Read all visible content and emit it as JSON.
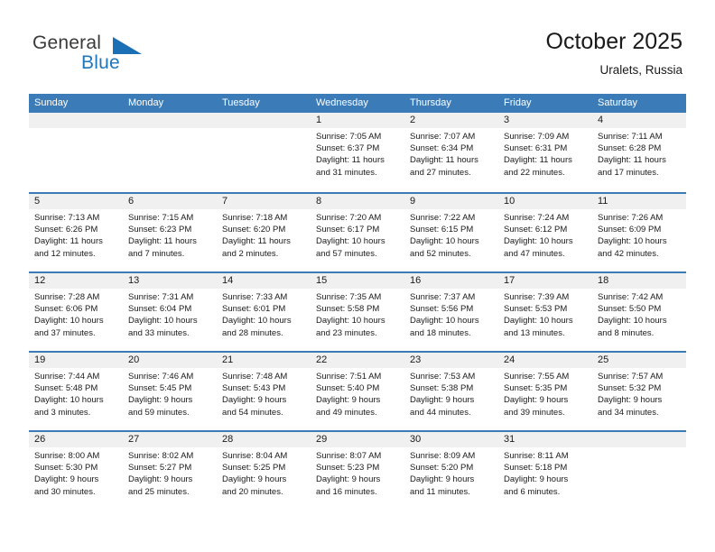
{
  "brand": {
    "name_top": "General",
    "name_bottom": "Blue",
    "triangle_color": "#1a6fb5",
    "top_color": "#3a3a3a",
    "bottom_color": "#1e76bd"
  },
  "header": {
    "title": "October 2025",
    "subtitle": "Uralets, Russia"
  },
  "calendar": {
    "header_bg": "#3b7cb8",
    "weekday_text_color": "#ffffff",
    "daynum_bg": "#f0f0f0",
    "weekdays": [
      "Sunday",
      "Monday",
      "Tuesday",
      "Wednesday",
      "Thursday",
      "Friday",
      "Saturday"
    ],
    "weeks": [
      [
        {
          "day": "",
          "empty": true
        },
        {
          "day": "",
          "empty": true
        },
        {
          "day": "",
          "empty": true
        },
        {
          "day": "1",
          "sunrise": "Sunrise: 7:05 AM",
          "sunset": "Sunset: 6:37 PM",
          "daylight_1": "Daylight: 11 hours",
          "daylight_2": "and 31 minutes."
        },
        {
          "day": "2",
          "sunrise": "Sunrise: 7:07 AM",
          "sunset": "Sunset: 6:34 PM",
          "daylight_1": "Daylight: 11 hours",
          "daylight_2": "and 27 minutes."
        },
        {
          "day": "3",
          "sunrise": "Sunrise: 7:09 AM",
          "sunset": "Sunset: 6:31 PM",
          "daylight_1": "Daylight: 11 hours",
          "daylight_2": "and 22 minutes."
        },
        {
          "day": "4",
          "sunrise": "Sunrise: 7:11 AM",
          "sunset": "Sunset: 6:28 PM",
          "daylight_1": "Daylight: 11 hours",
          "daylight_2": "and 17 minutes."
        }
      ],
      [
        {
          "day": "5",
          "sunrise": "Sunrise: 7:13 AM",
          "sunset": "Sunset: 6:26 PM",
          "daylight_1": "Daylight: 11 hours",
          "daylight_2": "and 12 minutes."
        },
        {
          "day": "6",
          "sunrise": "Sunrise: 7:15 AM",
          "sunset": "Sunset: 6:23 PM",
          "daylight_1": "Daylight: 11 hours",
          "daylight_2": "and 7 minutes."
        },
        {
          "day": "7",
          "sunrise": "Sunrise: 7:18 AM",
          "sunset": "Sunset: 6:20 PM",
          "daylight_1": "Daylight: 11 hours",
          "daylight_2": "and 2 minutes."
        },
        {
          "day": "8",
          "sunrise": "Sunrise: 7:20 AM",
          "sunset": "Sunset: 6:17 PM",
          "daylight_1": "Daylight: 10 hours",
          "daylight_2": "and 57 minutes."
        },
        {
          "day": "9",
          "sunrise": "Sunrise: 7:22 AM",
          "sunset": "Sunset: 6:15 PM",
          "daylight_1": "Daylight: 10 hours",
          "daylight_2": "and 52 minutes."
        },
        {
          "day": "10",
          "sunrise": "Sunrise: 7:24 AM",
          "sunset": "Sunset: 6:12 PM",
          "daylight_1": "Daylight: 10 hours",
          "daylight_2": "and 47 minutes."
        },
        {
          "day": "11",
          "sunrise": "Sunrise: 7:26 AM",
          "sunset": "Sunset: 6:09 PM",
          "daylight_1": "Daylight: 10 hours",
          "daylight_2": "and 42 minutes."
        }
      ],
      [
        {
          "day": "12",
          "sunrise": "Sunrise: 7:28 AM",
          "sunset": "Sunset: 6:06 PM",
          "daylight_1": "Daylight: 10 hours",
          "daylight_2": "and 37 minutes."
        },
        {
          "day": "13",
          "sunrise": "Sunrise: 7:31 AM",
          "sunset": "Sunset: 6:04 PM",
          "daylight_1": "Daylight: 10 hours",
          "daylight_2": "and 33 minutes."
        },
        {
          "day": "14",
          "sunrise": "Sunrise: 7:33 AM",
          "sunset": "Sunset: 6:01 PM",
          "daylight_1": "Daylight: 10 hours",
          "daylight_2": "and 28 minutes."
        },
        {
          "day": "15",
          "sunrise": "Sunrise: 7:35 AM",
          "sunset": "Sunset: 5:58 PM",
          "daylight_1": "Daylight: 10 hours",
          "daylight_2": "and 23 minutes."
        },
        {
          "day": "16",
          "sunrise": "Sunrise: 7:37 AM",
          "sunset": "Sunset: 5:56 PM",
          "daylight_1": "Daylight: 10 hours",
          "daylight_2": "and 18 minutes."
        },
        {
          "day": "17",
          "sunrise": "Sunrise: 7:39 AM",
          "sunset": "Sunset: 5:53 PM",
          "daylight_1": "Daylight: 10 hours",
          "daylight_2": "and 13 minutes."
        },
        {
          "day": "18",
          "sunrise": "Sunrise: 7:42 AM",
          "sunset": "Sunset: 5:50 PM",
          "daylight_1": "Daylight: 10 hours",
          "daylight_2": "and 8 minutes."
        }
      ],
      [
        {
          "day": "19",
          "sunrise": "Sunrise: 7:44 AM",
          "sunset": "Sunset: 5:48 PM",
          "daylight_1": "Daylight: 10 hours",
          "daylight_2": "and 3 minutes."
        },
        {
          "day": "20",
          "sunrise": "Sunrise: 7:46 AM",
          "sunset": "Sunset: 5:45 PM",
          "daylight_1": "Daylight: 9 hours",
          "daylight_2": "and 59 minutes."
        },
        {
          "day": "21",
          "sunrise": "Sunrise: 7:48 AM",
          "sunset": "Sunset: 5:43 PM",
          "daylight_1": "Daylight: 9 hours",
          "daylight_2": "and 54 minutes."
        },
        {
          "day": "22",
          "sunrise": "Sunrise: 7:51 AM",
          "sunset": "Sunset: 5:40 PM",
          "daylight_1": "Daylight: 9 hours",
          "daylight_2": "and 49 minutes."
        },
        {
          "day": "23",
          "sunrise": "Sunrise: 7:53 AM",
          "sunset": "Sunset: 5:38 PM",
          "daylight_1": "Daylight: 9 hours",
          "daylight_2": "and 44 minutes."
        },
        {
          "day": "24",
          "sunrise": "Sunrise: 7:55 AM",
          "sunset": "Sunset: 5:35 PM",
          "daylight_1": "Daylight: 9 hours",
          "daylight_2": "and 39 minutes."
        },
        {
          "day": "25",
          "sunrise": "Sunrise: 7:57 AM",
          "sunset": "Sunset: 5:32 PM",
          "daylight_1": "Daylight: 9 hours",
          "daylight_2": "and 34 minutes."
        }
      ],
      [
        {
          "day": "26",
          "sunrise": "Sunrise: 8:00 AM",
          "sunset": "Sunset: 5:30 PM",
          "daylight_1": "Daylight: 9 hours",
          "daylight_2": "and 30 minutes."
        },
        {
          "day": "27",
          "sunrise": "Sunrise: 8:02 AM",
          "sunset": "Sunset: 5:27 PM",
          "daylight_1": "Daylight: 9 hours",
          "daylight_2": "and 25 minutes."
        },
        {
          "day": "28",
          "sunrise": "Sunrise: 8:04 AM",
          "sunset": "Sunset: 5:25 PM",
          "daylight_1": "Daylight: 9 hours",
          "daylight_2": "and 20 minutes."
        },
        {
          "day": "29",
          "sunrise": "Sunrise: 8:07 AM",
          "sunset": "Sunset: 5:23 PM",
          "daylight_1": "Daylight: 9 hours",
          "daylight_2": "and 16 minutes."
        },
        {
          "day": "30",
          "sunrise": "Sunrise: 8:09 AM",
          "sunset": "Sunset: 5:20 PM",
          "daylight_1": "Daylight: 9 hours",
          "daylight_2": "and 11 minutes."
        },
        {
          "day": "31",
          "sunrise": "Sunrise: 8:11 AM",
          "sunset": "Sunset: 5:18 PM",
          "daylight_1": "Daylight: 9 hours",
          "daylight_2": "and 6 minutes."
        },
        {
          "day": "",
          "empty": true
        }
      ]
    ]
  }
}
